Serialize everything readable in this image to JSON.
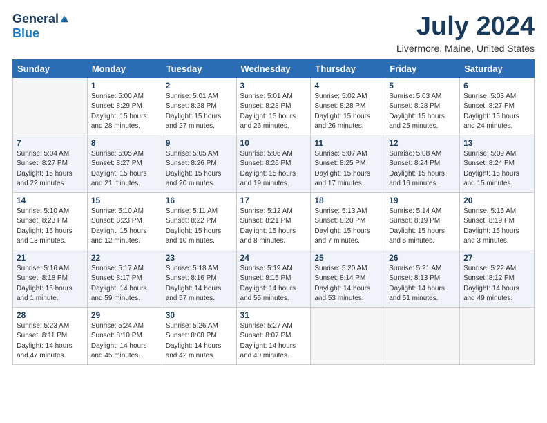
{
  "header": {
    "logo_general": "General",
    "logo_blue": "Blue",
    "month_title": "July 2024",
    "location": "Livermore, Maine, United States"
  },
  "weekdays": [
    "Sunday",
    "Monday",
    "Tuesday",
    "Wednesday",
    "Thursday",
    "Friday",
    "Saturday"
  ],
  "weeks": [
    [
      {
        "day": "",
        "empty": true
      },
      {
        "day": "1",
        "sunrise": "Sunrise: 5:00 AM",
        "sunset": "Sunset: 8:29 PM",
        "daylight": "Daylight: 15 hours and 28 minutes."
      },
      {
        "day": "2",
        "sunrise": "Sunrise: 5:01 AM",
        "sunset": "Sunset: 8:28 PM",
        "daylight": "Daylight: 15 hours and 27 minutes."
      },
      {
        "day": "3",
        "sunrise": "Sunrise: 5:01 AM",
        "sunset": "Sunset: 8:28 PM",
        "daylight": "Daylight: 15 hours and 26 minutes."
      },
      {
        "day": "4",
        "sunrise": "Sunrise: 5:02 AM",
        "sunset": "Sunset: 8:28 PM",
        "daylight": "Daylight: 15 hours and 26 minutes."
      },
      {
        "day": "5",
        "sunrise": "Sunrise: 5:03 AM",
        "sunset": "Sunset: 8:28 PM",
        "daylight": "Daylight: 15 hours and 25 minutes."
      },
      {
        "day": "6",
        "sunrise": "Sunrise: 5:03 AM",
        "sunset": "Sunset: 8:27 PM",
        "daylight": "Daylight: 15 hours and 24 minutes."
      }
    ],
    [
      {
        "day": "7",
        "sunrise": "Sunrise: 5:04 AM",
        "sunset": "Sunset: 8:27 PM",
        "daylight": "Daylight: 15 hours and 22 minutes."
      },
      {
        "day": "8",
        "sunrise": "Sunrise: 5:05 AM",
        "sunset": "Sunset: 8:27 PM",
        "daylight": "Daylight: 15 hours and 21 minutes."
      },
      {
        "day": "9",
        "sunrise": "Sunrise: 5:05 AM",
        "sunset": "Sunset: 8:26 PM",
        "daylight": "Daylight: 15 hours and 20 minutes."
      },
      {
        "day": "10",
        "sunrise": "Sunrise: 5:06 AM",
        "sunset": "Sunset: 8:26 PM",
        "daylight": "Daylight: 15 hours and 19 minutes."
      },
      {
        "day": "11",
        "sunrise": "Sunrise: 5:07 AM",
        "sunset": "Sunset: 8:25 PM",
        "daylight": "Daylight: 15 hours and 17 minutes."
      },
      {
        "day": "12",
        "sunrise": "Sunrise: 5:08 AM",
        "sunset": "Sunset: 8:24 PM",
        "daylight": "Daylight: 15 hours and 16 minutes."
      },
      {
        "day": "13",
        "sunrise": "Sunrise: 5:09 AM",
        "sunset": "Sunset: 8:24 PM",
        "daylight": "Daylight: 15 hours and 15 minutes."
      }
    ],
    [
      {
        "day": "14",
        "sunrise": "Sunrise: 5:10 AM",
        "sunset": "Sunset: 8:23 PM",
        "daylight": "Daylight: 15 hours and 13 minutes."
      },
      {
        "day": "15",
        "sunrise": "Sunrise: 5:10 AM",
        "sunset": "Sunset: 8:23 PM",
        "daylight": "Daylight: 15 hours and 12 minutes."
      },
      {
        "day": "16",
        "sunrise": "Sunrise: 5:11 AM",
        "sunset": "Sunset: 8:22 PM",
        "daylight": "Daylight: 15 hours and 10 minutes."
      },
      {
        "day": "17",
        "sunrise": "Sunrise: 5:12 AM",
        "sunset": "Sunset: 8:21 PM",
        "daylight": "Daylight: 15 hours and 8 minutes."
      },
      {
        "day": "18",
        "sunrise": "Sunrise: 5:13 AM",
        "sunset": "Sunset: 8:20 PM",
        "daylight": "Daylight: 15 hours and 7 minutes."
      },
      {
        "day": "19",
        "sunrise": "Sunrise: 5:14 AM",
        "sunset": "Sunset: 8:19 PM",
        "daylight": "Daylight: 15 hours and 5 minutes."
      },
      {
        "day": "20",
        "sunrise": "Sunrise: 5:15 AM",
        "sunset": "Sunset: 8:19 PM",
        "daylight": "Daylight: 15 hours and 3 minutes."
      }
    ],
    [
      {
        "day": "21",
        "sunrise": "Sunrise: 5:16 AM",
        "sunset": "Sunset: 8:18 PM",
        "daylight": "Daylight: 15 hours and 1 minute."
      },
      {
        "day": "22",
        "sunrise": "Sunrise: 5:17 AM",
        "sunset": "Sunset: 8:17 PM",
        "daylight": "Daylight: 14 hours and 59 minutes."
      },
      {
        "day": "23",
        "sunrise": "Sunrise: 5:18 AM",
        "sunset": "Sunset: 8:16 PM",
        "daylight": "Daylight: 14 hours and 57 minutes."
      },
      {
        "day": "24",
        "sunrise": "Sunrise: 5:19 AM",
        "sunset": "Sunset: 8:15 PM",
        "daylight": "Daylight: 14 hours and 55 minutes."
      },
      {
        "day": "25",
        "sunrise": "Sunrise: 5:20 AM",
        "sunset": "Sunset: 8:14 PM",
        "daylight": "Daylight: 14 hours and 53 minutes."
      },
      {
        "day": "26",
        "sunrise": "Sunrise: 5:21 AM",
        "sunset": "Sunset: 8:13 PM",
        "daylight": "Daylight: 14 hours and 51 minutes."
      },
      {
        "day": "27",
        "sunrise": "Sunrise: 5:22 AM",
        "sunset": "Sunset: 8:12 PM",
        "daylight": "Daylight: 14 hours and 49 minutes."
      }
    ],
    [
      {
        "day": "28",
        "sunrise": "Sunrise: 5:23 AM",
        "sunset": "Sunset: 8:11 PM",
        "daylight": "Daylight: 14 hours and 47 minutes."
      },
      {
        "day": "29",
        "sunrise": "Sunrise: 5:24 AM",
        "sunset": "Sunset: 8:10 PM",
        "daylight": "Daylight: 14 hours and 45 minutes."
      },
      {
        "day": "30",
        "sunrise": "Sunrise: 5:26 AM",
        "sunset": "Sunset: 8:08 PM",
        "daylight": "Daylight: 14 hours and 42 minutes."
      },
      {
        "day": "31",
        "sunrise": "Sunrise: 5:27 AM",
        "sunset": "Sunset: 8:07 PM",
        "daylight": "Daylight: 14 hours and 40 minutes."
      },
      {
        "day": "",
        "empty": true
      },
      {
        "day": "",
        "empty": true
      },
      {
        "day": "",
        "empty": true
      }
    ]
  ]
}
